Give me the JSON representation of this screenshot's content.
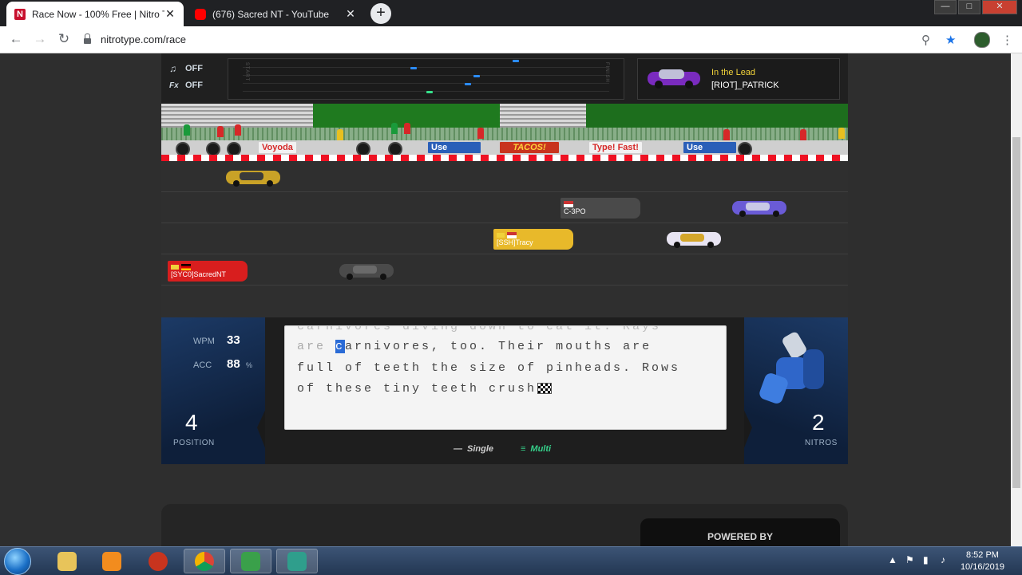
{
  "browser": {
    "tabs": [
      {
        "title": "Race Now - 100% Free | Nitro Type",
        "favicon_color": "#c8102e",
        "active": true
      },
      {
        "title": "(676) Sacred NT - YouTube",
        "favicon_color": "#ff0000",
        "active": false
      }
    ],
    "new_tab": "+",
    "url": "nitrotype.com/race",
    "window_buttons": {
      "minimize": "—",
      "maximize": "□",
      "close": "✕"
    }
  },
  "race": {
    "sound": {
      "music_label": "OFF",
      "fx_icon": "Fx",
      "fx_label": "OFF"
    },
    "minitrack": {
      "start_label": "START",
      "finish_label": "FINISH"
    },
    "leader": {
      "label": "In the Lead",
      "name": "[RIOT]_PATRICK"
    },
    "ads": [
      "Voyoda",
      "Use",
      "TACOS!",
      "Type! Fast!",
      "Use"
    ],
    "racers": [
      {
        "name": "",
        "car_color": "#c9a227",
        "tag_color": ""
      },
      {
        "name": "C-3PO",
        "car_color": "#6a5bd6",
        "tag_color": "#4a4a4a"
      },
      {
        "name": "[SSH]Tracy",
        "car_color": "#e8e4f2",
        "tag_color": "#e8b92a"
      },
      {
        "name": "[SYC0]SacredNT",
        "car_color": "#4a4a4a",
        "tag_color": "#d81e1e"
      }
    ],
    "stats": {
      "wpm_label": "WPM",
      "wpm": "33",
      "acc_label": "ACC",
      "acc": "88",
      "acc_unit": "%",
      "position": "4",
      "position_label": "POSITION",
      "nitros": "2",
      "nitros_label": "NITROS"
    },
    "text": {
      "line0": "carnivores diving down to eat it. Rays",
      "line1_before": "are ",
      "line1_cursor": "c",
      "line1_after": "arnivores, too. Their mouths are",
      "line2": "full of teeth the size of pinheads. Rows",
      "line3": "of these tiny teeth crush"
    },
    "modes": {
      "single": "Single",
      "multi": "Multi"
    }
  },
  "lower": {
    "powered_by": "POWERED BY"
  },
  "taskbar": {
    "time": "8:52 PM",
    "date": "10/16/2019"
  }
}
